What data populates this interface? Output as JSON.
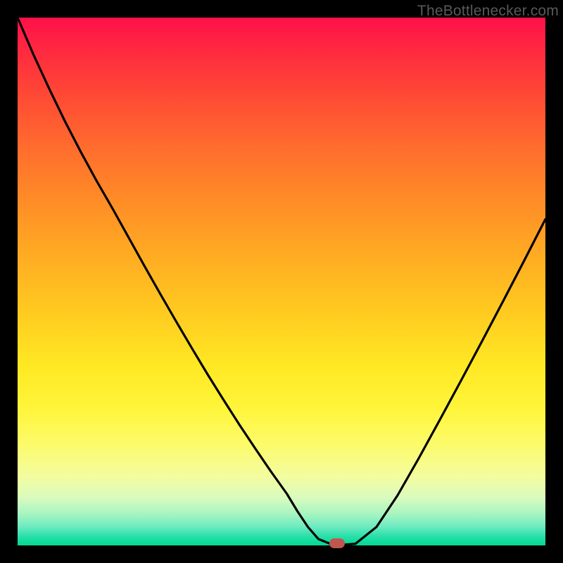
{
  "watermark": "TheBottlenecker.com",
  "chart_data": {
    "type": "line",
    "title": "",
    "xlabel": "",
    "ylabel": "",
    "xlim": [
      0,
      100
    ],
    "ylim": [
      0,
      100
    ],
    "x": [
      0,
      3,
      6,
      9,
      12,
      15,
      18,
      21,
      24,
      27,
      30,
      33,
      36,
      39,
      42,
      45,
      48,
      51,
      53,
      55,
      57,
      60,
      64,
      68,
      72,
      76,
      80,
      84,
      88,
      92,
      96,
      100
    ],
    "values": [
      100,
      93,
      86.5,
      80.3,
      74.5,
      69,
      63.8,
      58.4,
      53,
      47.7,
      42.5,
      37.4,
      32.4,
      27.6,
      22.9,
      18.4,
      14,
      9.8,
      6.5,
      3.5,
      1.2,
      0,
      0.3,
      3.5,
      9.5,
      16.5,
      23.8,
      31.2,
      38.7,
      46.3,
      54,
      61.8
    ],
    "marker": {
      "x": 60.5,
      "y": 0
    },
    "grid": false,
    "legend": false
  },
  "colors": {
    "curve": "#000000",
    "marker": "#c1554f",
    "frame": "#000000"
  }
}
